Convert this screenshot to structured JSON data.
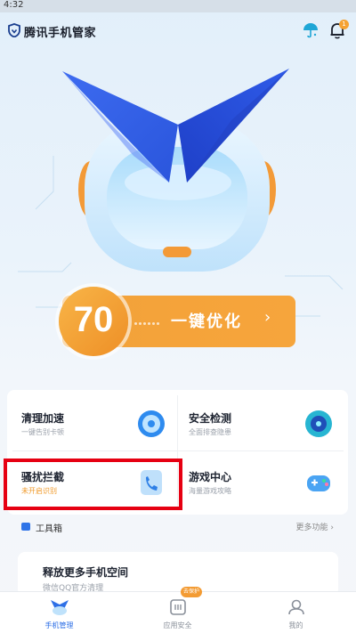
{
  "status_bar": {
    "time": "4:32"
  },
  "header": {
    "title": "腾讯手机管家",
    "bell_badge": "1"
  },
  "score": {
    "value": "70",
    "action_label": "一键优化",
    "arrow": "›"
  },
  "features": [
    {
      "title": "清理加速",
      "subtitle": "一键告别卡顿",
      "icon": "speed-icon"
    },
    {
      "title": "安全检测",
      "subtitle": "全面排查隐患",
      "icon": "radar-icon"
    },
    {
      "title": "骚扰拦截",
      "subtitle": "未开启识别",
      "icon": "phone-block-icon"
    },
    {
      "title": "游戏中心",
      "subtitle": "海量游戏攻略",
      "icon": "gamepad-icon"
    }
  ],
  "toolbox": {
    "label": "工具箱",
    "more": "更多功能 ›"
  },
  "recommendation": {
    "title": "释放更多手机空间",
    "subtitle": "微信QQ官方清理"
  },
  "nav": [
    {
      "label": "手机管理",
      "active": true
    },
    {
      "label": "应用安全",
      "badge": "去保护"
    },
    {
      "label": "我的"
    }
  ],
  "colors": {
    "accent": "#2d6fe6",
    "orange": "#f5a23a",
    "highlight": "#e60012"
  }
}
